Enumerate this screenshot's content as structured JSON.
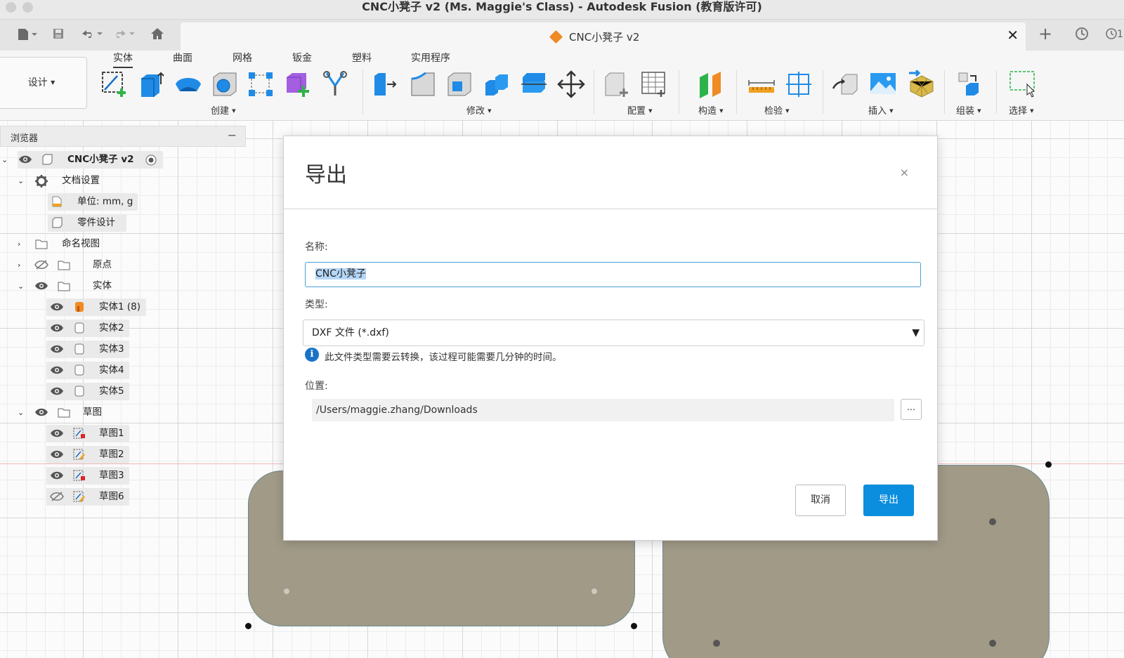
{
  "window": {
    "title": "CNC小凳子 v2 (Ms. Maggie's Class) - Autodesk Fusion (教育版许可)"
  },
  "tabbar": {
    "doc_title": "CNC小凳子 v2",
    "close_glyph": "✕",
    "add_glyph": "+",
    "right_text": "1"
  },
  "ribbon": {
    "workspace": "设计",
    "tabs": [
      "实体",
      "曲面",
      "网格",
      "钣金",
      "塑料",
      "实用程序"
    ],
    "active_tab": "实体",
    "groups": [
      "创建",
      "修改",
      "配置",
      "构造",
      "检验",
      "插入",
      "组装",
      "选择"
    ]
  },
  "browser": {
    "title": "浏览器",
    "collapse": "−",
    "root": "CNC小凳子 v2",
    "doc_settings": "文档设置",
    "units": "单位: mm, g",
    "design_type": "零件设计",
    "named_views": "命名视图",
    "origin": "原点",
    "bodies_folder": "实体",
    "bodies": [
      "实体1 (8)",
      "实体2",
      "实体3",
      "实体4",
      "实体5"
    ],
    "sketches_folder": "草图",
    "sketches": [
      "草图1",
      "草图2",
      "草图3",
      "草图6"
    ]
  },
  "dialog": {
    "title": "导出",
    "close": "×",
    "name_label": "名称:",
    "name_value": "CNC小凳子",
    "type_label": "类型:",
    "type_value": "DXF 文件 (*.dxf)",
    "info_text": "此文件类型需要云转换，该过程可能需要几分钟的时间。",
    "location_label": "位置:",
    "location_value": "/Users/maggie.zhang/Downloads",
    "browse": "...",
    "cancel": "取消",
    "export": "导出"
  },
  "colors": {
    "accent": "#0b8ede",
    "part_fill": "#a09a87",
    "input_focus": "#4a9fd6",
    "info": "#1a73c7"
  }
}
